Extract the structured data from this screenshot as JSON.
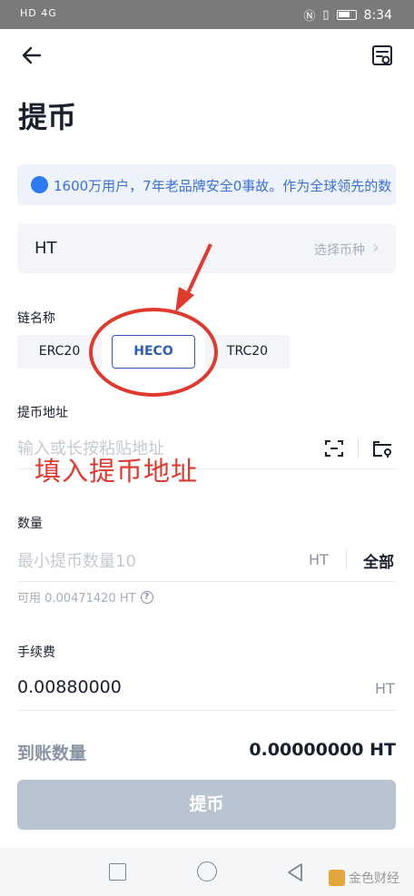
{
  "status_bar": {
    "network": "HD 4G",
    "time": "8:34"
  },
  "nav": {
    "back_icon": "arrow-left-icon",
    "records_icon": "withdraw-records-icon"
  },
  "page": {
    "title": "提币"
  },
  "notice": {
    "text": "1600万用户，7年老品牌安全0事故。作为全球领先的数"
  },
  "coin": {
    "symbol": "HT",
    "select_hint": "选择币种"
  },
  "chain": {
    "label": "链名称",
    "options": [
      "ERC20",
      "HECO",
      "TRC20"
    ],
    "selected": "HECO"
  },
  "address": {
    "label": "提币地址",
    "placeholder": "输入或长按粘贴地址"
  },
  "annotation": {
    "text": "填入提币地址",
    "color": "#e03a2f"
  },
  "amount": {
    "label": "数量",
    "placeholder": "最小提币数量10",
    "unit": "HT",
    "all_label": "全部",
    "available": "可用 0.00471420 HT"
  },
  "fee": {
    "label": "手续费",
    "value": "0.00880000",
    "unit": "HT"
  },
  "receive": {
    "label": "到账数量",
    "value": "0.00000000 HT"
  },
  "submit": {
    "label": "提币",
    "enabled": false
  },
  "watermark": {
    "text": "金色财经"
  },
  "colors": {
    "primary": "#2d5fb0",
    "button_disabled": "#b9c4d2",
    "annotation": "#e03a2f"
  }
}
